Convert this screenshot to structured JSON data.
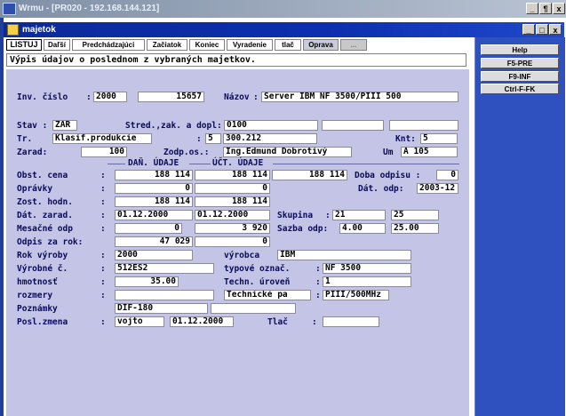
{
  "outer_window": {
    "title": "Wrmu - [PR020 - 192.168.144.121]",
    "buttons": [
      "_",
      "¶",
      "x"
    ]
  },
  "window": {
    "title": "majetok",
    "buttons": [
      "_",
      "□",
      "x"
    ]
  },
  "toolbar": {
    "items": [
      "LISTUJ",
      "Daľší",
      "Predchádzajúci",
      "Začiatok",
      "Koniec",
      "Vyradenie",
      "tlač",
      "Oprava",
      "..."
    ]
  },
  "right_panel": {
    "buttons": [
      "Help",
      "F5-PRE",
      "F9-INF",
      "Ctrl-F-FK"
    ]
  },
  "heading": "Výpis údajov o poslednom z vybraných majetkov.",
  "form": {
    "inv_cislo_label": "Inv. číslo",
    "inv_cislo_1": "2000",
    "inv_cislo_2": "15657",
    "nazov_label": "Názov",
    "nazov": "Server IBM NF 3500/PIII 500",
    "stav_label": "Stav :",
    "stav": "ZAR",
    "stred_label": "Stred.,zak. a dopl:",
    "stred": "0100",
    "stred_2": "",
    "stred_3": "",
    "tr_label": "Tr.",
    "tr": "Klasif.produkcie",
    "tr_sep": ":",
    "tr_num": "5",
    "tr_code": "300.212",
    "knt_label": "Knt:",
    "knt": "5",
    "zarad_label": "Zarad:",
    "zarad": "100",
    "zodp_label": "Zodp.os.:",
    "zodp": "Ing.Edmund Dobrotivý",
    "um_label": "Um",
    "um": "A 105",
    "dan_udaje": "DAŇ. ÚDAJE",
    "uct_udaje": "ÚČT. ÚDAJE",
    "obst_label": "Obst. cena",
    "obst_dan": "188 114",
    "obst_uct": "188 114",
    "obst_3": "188 114",
    "doba_label": "Doba odpisu :",
    "doba": "0",
    "opravky_label": "Oprávky",
    "opravky_dan": "0",
    "opravky_uct": "0",
    "dat_odp_label": "Dát. odp:",
    "dat_odp": "2003-12",
    "zost_label": "Zost. hodn.",
    "zost_dan": "188 114",
    "zost_uct": "188 114",
    "dat_zarad_label": "Dát. zarad.",
    "dat_zarad_dan": "01.12.2000",
    "dat_zarad_uct": "01.12.2000",
    "skupina_label": "Skupina",
    "skupina": "21",
    "skupina_2": "25",
    "mes_odp_label": "Mesačné odp",
    "mes_odp_dan": "0",
    "mes_odp_uct": "3 920",
    "sazba_label": "Sazba odp:",
    "sazba_1": "4.00",
    "sazba_2": "25.00",
    "odpis_rok_label": "Odpis za rok:",
    "odpis_rok_dan": "47 029",
    "odpis_rok_uct": "0",
    "rok_vyroby_label": "Rok výroby",
    "rok_vyroby": "2000",
    "vyrobca_label": "výrobca",
    "vyrobca": "IBM",
    "vyrobne_c_label": "Výrobné č.",
    "vyrobne_c": "512ES2",
    "typove_label": "typové označ.",
    "typove": "NF 3500",
    "hmotnost_label": "hmotnosť",
    "hmotnost": "35.00",
    "techn_label": "Techn. úroveň",
    "techn": "1",
    "rozmery_label": "rozmery",
    "rozmery": "",
    "technicke_pa": "Technické pa",
    "technicke_val": "PIII/500MHz",
    "poznamky_label": "Poznámky",
    "poznamky": "DIF-180",
    "posl_label": "Posl.zmena",
    "posl_user": "vojto",
    "posl_date": "01.12.2000",
    "tlac_label": "Tlač",
    "tlac": ""
  }
}
